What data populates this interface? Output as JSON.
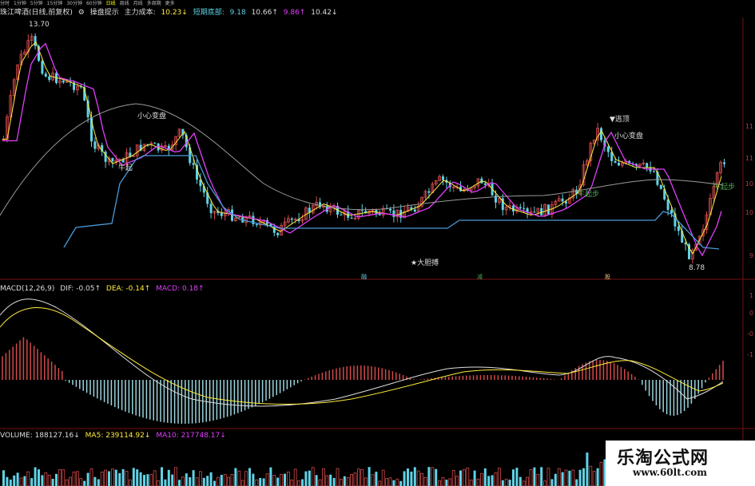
{
  "toolbar": {
    "items": [
      "分时",
      "1分钟",
      "5分钟",
      "15分钟",
      "30分钟",
      "60分钟",
      "日线",
      "周线",
      "月线",
      "多周期",
      "更多"
    ],
    "active_index": 6
  },
  "main_info": {
    "stock": "珠江啤酒(日线,前复权)",
    "indicator_icon": "gear-icon",
    "indicator": "操盘提示",
    "cost_label": "主力成本:",
    "cost_value": "10.23↓",
    "bottom_label": "短期底部:",
    "bottom_value": "9.18",
    "v3": "10.66↑",
    "v4": "9.86↑",
    "v5": "10.42↓"
  },
  "annotations": {
    "high": "13.70",
    "careful1": "小心变盘",
    "niuqi1": "牛起",
    "dadanbu": "★大胆搏",
    "taoding": "▼逃顶",
    "careful2": "小心变盘",
    "niuqibu1": "牛起步",
    "niuqibu2": "牛起步",
    "low": "8.78",
    "marker1": "融",
    "marker2": "减",
    "marker3": "股"
  },
  "macd_info": {
    "label": "MACD(12,26,9)",
    "dif": "DIF: -0.05↑",
    "dea": "DEA: -0.14↑",
    "macd": "MACD: 0.18↑"
  },
  "vol_info": {
    "label": "VOLUME: 188127.16↓",
    "ma5": "MA5: 239114.92↓",
    "ma10": "MA10: 217748.17↓"
  },
  "right_ticks": [
    "11",
    "11",
    "10",
    "10",
    "9",
    "1",
    "0",
    "-0",
    "-1"
  ],
  "watermark": {
    "title": "乐淘公式网",
    "url": "www.60lt.com"
  },
  "colors": {
    "up": "#d24a4a",
    "down": "#5fd3e6",
    "ma5": "#ffeb3b",
    "ma10": "#e040fb",
    "ma_long": "#9a9a9a",
    "support": "#4a9ad8"
  }
}
